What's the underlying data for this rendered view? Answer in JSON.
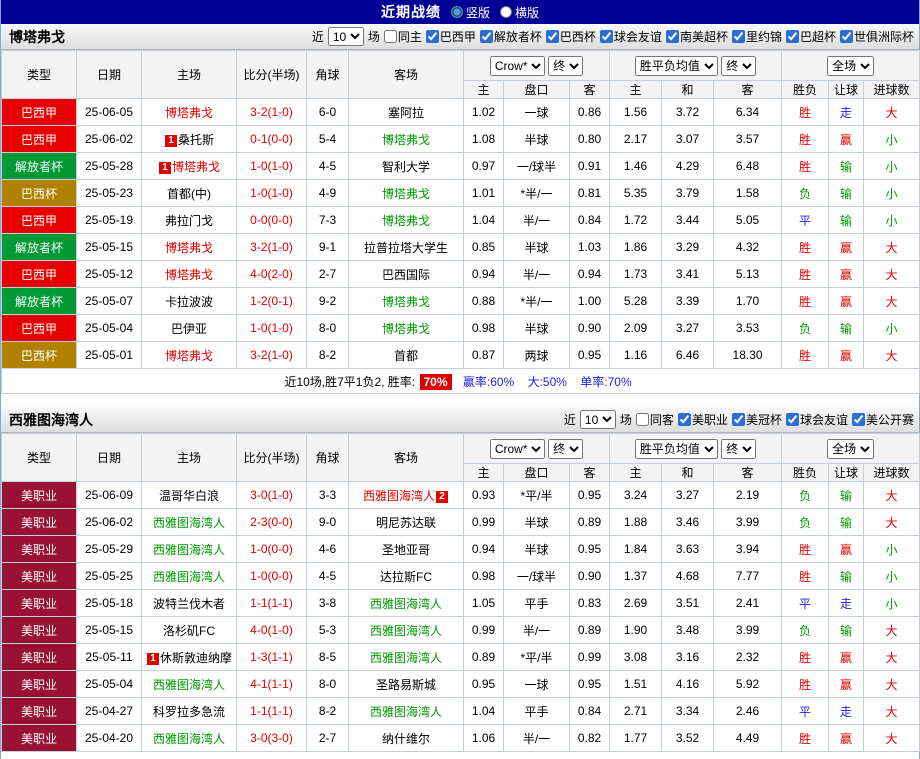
{
  "colors": {
    "topbar_bg": "#000095",
    "accent_red": "#e00000",
    "accent_green": "#009900",
    "accent_blue": "#2323d5",
    "league_colors": {
      "巴西甲": "#e60000",
      "解放者杯": "#009933",
      "巴西杯": "#b08000",
      "美职业": "#991133"
    }
  },
  "topbar": {
    "title": "近期战绩",
    "vertical": "竖版",
    "horizontal": "横版",
    "vertical_selected": true
  },
  "table_header": {
    "col_type": "类型",
    "col_date": "日期",
    "col_home": "主场",
    "col_score": "比分(半场)",
    "col_corner": "角球",
    "col_away": "客场",
    "odds_select": "Crow*",
    "odds_final": "终",
    "avg_select": "胜平负均值",
    "avg_final": "终",
    "scope_select": "全场",
    "sub": [
      "主",
      "盘口",
      "客",
      "主",
      "和",
      "客",
      "胜负",
      "让球",
      "进球数"
    ]
  },
  "sections": [
    {
      "team": "博塔弗戈",
      "near_label": "近",
      "count_value": "10",
      "games_label": "场",
      "filters": [
        {
          "label": "同主",
          "checked": false
        },
        {
          "label": "巴西甲",
          "checked": true
        },
        {
          "label": "解放者杯",
          "checked": true
        },
        {
          "label": "巴西杯",
          "checked": true
        },
        {
          "label": "球会友谊",
          "checked": true
        },
        {
          "label": "南美超杯",
          "checked": true
        },
        {
          "label": "里约锦",
          "checked": true
        },
        {
          "label": "巴超杯",
          "checked": true
        },
        {
          "label": "世俱洲际杯",
          "checked": true
        }
      ],
      "rows": [
        {
          "league": "巴西甲",
          "date": "25-06-05",
          "home": "博塔弗戈",
          "home_color": "red",
          "score": "3-2(1-0)",
          "corner": "6-0",
          "away": "塞阿拉",
          "away_color": "black",
          "odds": [
            "1.02",
            "一球",
            "0.86"
          ],
          "avg": [
            "1.56",
            "3.72",
            "6.34"
          ],
          "results": [
            {
              "t": "胜",
              "c": "red"
            },
            {
              "t": "走",
              "c": "blue"
            },
            {
              "t": "大",
              "c": "red"
            }
          ]
        },
        {
          "league": "巴西甲",
          "date": "25-06-02",
          "home": "桑托斯",
          "home_color": "black",
          "home_badge": "1",
          "score": "0-1(0-0)",
          "corner": "5-4",
          "away": "博塔弗戈",
          "away_color": "green",
          "odds": [
            "1.08",
            "半球",
            "0.80"
          ],
          "avg": [
            "2.17",
            "3.07",
            "3.57"
          ],
          "results": [
            {
              "t": "胜",
              "c": "red"
            },
            {
              "t": "赢",
              "c": "red"
            },
            {
              "t": "小",
              "c": "green"
            }
          ]
        },
        {
          "league": "解放者杯",
          "date": "25-05-28",
          "home": "博塔弗戈",
          "home_color": "red",
          "home_badge": "1",
          "score": "1-0(1-0)",
          "corner": "4-5",
          "away": "智利大学",
          "away_color": "black",
          "odds": [
            "0.97",
            "一/球半",
            "0.91"
          ],
          "avg": [
            "1.46",
            "4.29",
            "6.48"
          ],
          "results": [
            {
              "t": "胜",
              "c": "red"
            },
            {
              "t": "输",
              "c": "green"
            },
            {
              "t": "小",
              "c": "green"
            }
          ]
        },
        {
          "league": "巴西杯",
          "date": "25-05-23",
          "home": "首都(中)",
          "home_color": "black",
          "score": "1-0(1-0)",
          "corner": "4-9",
          "away": "博塔弗戈",
          "away_color": "green",
          "odds": [
            "1.01",
            "*半/一",
            "0.81"
          ],
          "avg": [
            "5.35",
            "3.79",
            "1.58"
          ],
          "results": [
            {
              "t": "负",
              "c": "green"
            },
            {
              "t": "输",
              "c": "green"
            },
            {
              "t": "小",
              "c": "green"
            }
          ]
        },
        {
          "league": "巴西甲",
          "date": "25-05-19",
          "home": "弗拉门戈",
          "home_color": "black",
          "score": "0-0(0-0)",
          "corner": "7-3",
          "away": "博塔弗戈",
          "away_color": "green",
          "odds": [
            "1.04",
            "半/一",
            "0.84"
          ],
          "avg": [
            "1.72",
            "3.44",
            "5.05"
          ],
          "results": [
            {
              "t": "平",
              "c": "blue"
            },
            {
              "t": "输",
              "c": "green"
            },
            {
              "t": "小",
              "c": "green"
            }
          ]
        },
        {
          "league": "解放者杯",
          "date": "25-05-15",
          "home": "博塔弗戈",
          "home_color": "red",
          "score": "3-2(1-0)",
          "corner": "9-1",
          "away": "拉普拉塔大学生",
          "away_color": "black",
          "odds": [
            "0.85",
            "半球",
            "1.03"
          ],
          "avg": [
            "1.86",
            "3.29",
            "4.32"
          ],
          "results": [
            {
              "t": "胜",
              "c": "red"
            },
            {
              "t": "赢",
              "c": "red"
            },
            {
              "t": "大",
              "c": "red"
            }
          ]
        },
        {
          "league": "巴西甲",
          "date": "25-05-12",
          "home": "博塔弗戈",
          "home_color": "red",
          "score": "4-0(2-0)",
          "corner": "2-7",
          "away": "巴西国际",
          "away_color": "black",
          "odds": [
            "0.94",
            "半/一",
            "0.94"
          ],
          "avg": [
            "1.73",
            "3.41",
            "5.13"
          ],
          "results": [
            {
              "t": "胜",
              "c": "red"
            },
            {
              "t": "赢",
              "c": "red"
            },
            {
              "t": "大",
              "c": "red"
            }
          ]
        },
        {
          "league": "解放者杯",
          "date": "25-05-07",
          "home": "卡拉波波",
          "home_color": "black",
          "score": "1-2(0-1)",
          "corner": "9-2",
          "away": "博塔弗戈",
          "away_color": "green",
          "odds": [
            "0.88",
            "*半/一",
            "1.00"
          ],
          "avg": [
            "5.28",
            "3.39",
            "1.70"
          ],
          "results": [
            {
              "t": "胜",
              "c": "red"
            },
            {
              "t": "赢",
              "c": "red"
            },
            {
              "t": "大",
              "c": "red"
            }
          ]
        },
        {
          "league": "巴西甲",
          "date": "25-05-04",
          "home": "巴伊亚",
          "home_color": "black",
          "score": "1-0(1-0)",
          "corner": "8-0",
          "away": "博塔弗戈",
          "away_color": "green",
          "odds": [
            "0.98",
            "半球",
            "0.90"
          ],
          "avg": [
            "2.09",
            "3.27",
            "3.53"
          ],
          "results": [
            {
              "t": "负",
              "c": "green"
            },
            {
              "t": "输",
              "c": "green"
            },
            {
              "t": "小",
              "c": "green"
            }
          ]
        },
        {
          "league": "巴西杯",
          "date": "25-05-01",
          "home": "博塔弗戈",
          "home_color": "red",
          "score": "3-2(1-0)",
          "corner": "8-2",
          "away": "首都",
          "away_color": "black",
          "odds": [
            "0.87",
            "两球",
            "0.95"
          ],
          "avg": [
            "1.16",
            "6.46",
            "18.30"
          ],
          "results": [
            {
              "t": "胜",
              "c": "red"
            },
            {
              "t": "赢",
              "c": "red"
            },
            {
              "t": "大",
              "c": "red"
            }
          ]
        }
      ],
      "summary": {
        "prefix": "近10场,胜7平1负2, 胜率:",
        "win_rate": "70%",
        "s1": "赢率:60%",
        "s2": "大:50%",
        "s3": "单率:70%"
      }
    },
    {
      "team": "西雅图海湾人",
      "near_label": "近",
      "count_value": "10",
      "games_label": "场",
      "filters": [
        {
          "label": "同客",
          "checked": false
        },
        {
          "label": "美职业",
          "checked": true
        },
        {
          "label": "美冠杯",
          "checked": true
        },
        {
          "label": "球会友谊",
          "checked": true
        },
        {
          "label": "美公开赛",
          "checked": true
        }
      ],
      "rows": [
        {
          "league": "美职业",
          "date": "25-06-09",
          "home": "温哥华白浪",
          "home_color": "black",
          "score": "3-0(1-0)",
          "corner": "3-3",
          "away": "西雅图海湾人",
          "away_color": "red",
          "away_badge": "2",
          "odds": [
            "0.93",
            "*平/半",
            "0.95"
          ],
          "avg": [
            "3.24",
            "3.27",
            "2.19"
          ],
          "results": [
            {
              "t": "负",
              "c": "green"
            },
            {
              "t": "输",
              "c": "green"
            },
            {
              "t": "大",
              "c": "red"
            }
          ]
        },
        {
          "league": "美职业",
          "date": "25-06-02",
          "home": "西雅图海湾人",
          "home_color": "green",
          "score": "2-3(0-0)",
          "corner": "9-0",
          "away": "明尼苏达联",
          "away_color": "black",
          "odds": [
            "0.99",
            "半球",
            "0.89"
          ],
          "avg": [
            "1.88",
            "3.46",
            "3.99"
          ],
          "results": [
            {
              "t": "负",
              "c": "green"
            },
            {
              "t": "输",
              "c": "green"
            },
            {
              "t": "大",
              "c": "red"
            }
          ]
        },
        {
          "league": "美职业",
          "date": "25-05-29",
          "home": "西雅图海湾人",
          "home_color": "green",
          "score": "1-0(0-0)",
          "corner": "4-6",
          "away": "圣地亚哥",
          "away_color": "black",
          "odds": [
            "0.94",
            "半球",
            "0.95"
          ],
          "avg": [
            "1.84",
            "3.63",
            "3.94"
          ],
          "results": [
            {
              "t": "胜",
              "c": "red"
            },
            {
              "t": "赢",
              "c": "red"
            },
            {
              "t": "小",
              "c": "green"
            }
          ]
        },
        {
          "league": "美职业",
          "date": "25-05-25",
          "home": "西雅图海湾人",
          "home_color": "green",
          "score": "1-0(0-0)",
          "corner": "4-5",
          "away": "达拉斯FC",
          "away_color": "black",
          "odds": [
            "0.98",
            "一/球半",
            "0.90"
          ],
          "avg": [
            "1.37",
            "4.68",
            "7.77"
          ],
          "results": [
            {
              "t": "胜",
              "c": "red"
            },
            {
              "t": "输",
              "c": "green"
            },
            {
              "t": "小",
              "c": "green"
            }
          ]
        },
        {
          "league": "美职业",
          "date": "25-05-18",
          "home": "波特兰伐木者",
          "home_color": "black",
          "score": "1-1(1-1)",
          "corner": "3-8",
          "away": "西雅图海湾人",
          "away_color": "green",
          "odds": [
            "1.05",
            "平手",
            "0.83"
          ],
          "avg": [
            "2.69",
            "3.51",
            "2.41"
          ],
          "results": [
            {
              "t": "平",
              "c": "blue"
            },
            {
              "t": "走",
              "c": "blue"
            },
            {
              "t": "小",
              "c": "green"
            }
          ]
        },
        {
          "league": "美职业",
          "date": "25-05-15",
          "home": "洛杉矶FC",
          "home_color": "black",
          "score": "4-0(1-0)",
          "corner": "5-3",
          "away": "西雅图海湾人",
          "away_color": "green",
          "odds": [
            "0.99",
            "半/一",
            "0.89"
          ],
          "avg": [
            "1.90",
            "3.48",
            "3.99"
          ],
          "results": [
            {
              "t": "负",
              "c": "green"
            },
            {
              "t": "输",
              "c": "green"
            },
            {
              "t": "大",
              "c": "red"
            }
          ]
        },
        {
          "league": "美职业",
          "date": "25-05-11",
          "home": "休斯敦迪纳摩",
          "home_color": "black",
          "home_badge": "1",
          "score": "1-3(1-1)",
          "corner": "8-5",
          "away": "西雅图海湾人",
          "away_color": "green",
          "odds": [
            "0.89",
            "*平/半",
            "0.99"
          ],
          "avg": [
            "3.08",
            "3.16",
            "2.32"
          ],
          "results": [
            {
              "t": "胜",
              "c": "red"
            },
            {
              "t": "赢",
              "c": "red"
            },
            {
              "t": "大",
              "c": "red"
            }
          ]
        },
        {
          "league": "美职业",
          "date": "25-05-04",
          "home": "西雅图海湾人",
          "home_color": "green",
          "score": "4-1(1-1)",
          "corner": "8-0",
          "away": "圣路易斯城",
          "away_color": "black",
          "odds": [
            "0.95",
            "一球",
            "0.95"
          ],
          "avg": [
            "1.51",
            "4.16",
            "5.92"
          ],
          "results": [
            {
              "t": "胜",
              "c": "red"
            },
            {
              "t": "赢",
              "c": "red"
            },
            {
              "t": "大",
              "c": "red"
            }
          ]
        },
        {
          "league": "美职业",
          "date": "25-04-27",
          "home": "科罗拉多急流",
          "home_color": "black",
          "score": "1-1(1-1)",
          "corner": "8-2",
          "away": "西雅图海湾人",
          "away_color": "green",
          "odds": [
            "1.04",
            "平手",
            "0.84"
          ],
          "avg": [
            "2.71",
            "3.34",
            "2.46"
          ],
          "results": [
            {
              "t": "平",
              "c": "blue"
            },
            {
              "t": "走",
              "c": "blue"
            },
            {
              "t": "大",
              "c": "red"
            }
          ]
        },
        {
          "league": "美职业",
          "date": "25-04-20",
          "home": "西雅图海湾人",
          "home_color": "green",
          "score": "3-0(3-0)",
          "corner": "2-7",
          "away": "纳什维尔",
          "away_color": "black",
          "odds": [
            "1.06",
            "半/一",
            "0.82"
          ],
          "avg": [
            "1.77",
            "3.52",
            "4.49"
          ],
          "results": [
            {
              "t": "胜",
              "c": "red"
            },
            {
              "t": "赢",
              "c": "red"
            },
            {
              "t": "大",
              "c": "red"
            }
          ]
        }
      ]
    }
  ]
}
